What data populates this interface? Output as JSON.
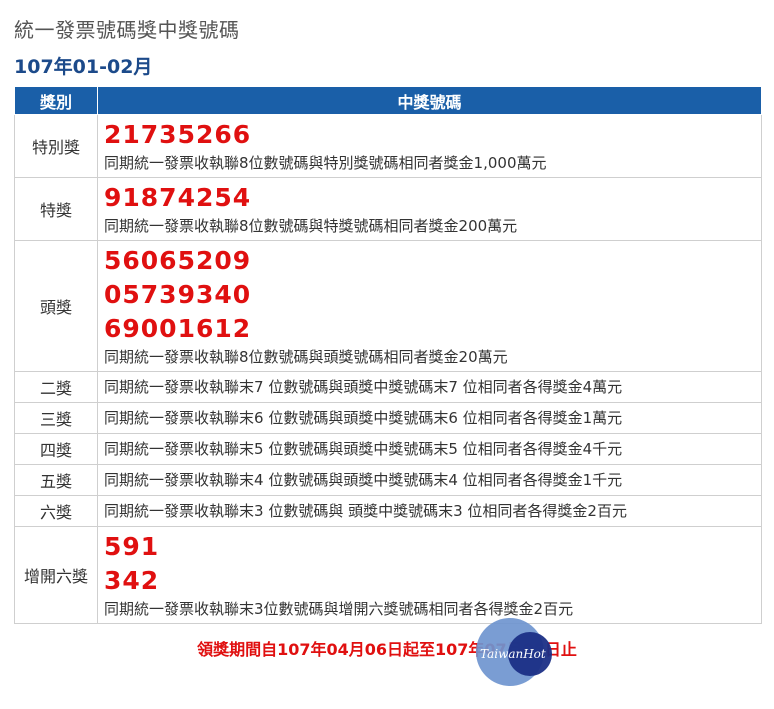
{
  "header": {
    "title": "統一發票號碼獎中獎號碼",
    "period": "107年01-02月"
  },
  "table": {
    "col_category": "獎別",
    "col_numbers": "中獎號碼",
    "rows": [
      {
        "category": "特別獎",
        "numbers": [
          "21735266"
        ],
        "desc": "同期統一發票收執聯8位數號碼與特別獎號碼相同者獎金1,000萬元"
      },
      {
        "category": "特獎",
        "numbers": [
          "91874254"
        ],
        "desc": "同期統一發票收執聯8位數號碼與特獎號碼相同者獎金200萬元"
      },
      {
        "category": "頭獎",
        "numbers": [
          "56065209",
          "05739340",
          "69001612"
        ],
        "desc": "同期統一發票收執聯8位數號碼與頭獎號碼相同者獎金20萬元"
      },
      {
        "category": "二獎",
        "desc": "同期統一發票收執聯末7 位數號碼與頭獎中獎號碼末7 位相同者各得獎金4萬元"
      },
      {
        "category": "三獎",
        "desc": "同期統一發票收執聯末6 位數號碼與頭獎中獎號碼末6 位相同者各得獎金1萬元"
      },
      {
        "category": "四獎",
        "desc": "同期統一發票收執聯末5 位數號碼與頭獎中獎號碼末5 位相同者各得獎金4千元"
      },
      {
        "category": "五獎",
        "desc": "同期統一發票收執聯末4 位數號碼與頭獎中獎號碼末4 位相同者各得獎金1千元"
      },
      {
        "category": "六獎",
        "desc": "同期統一發票收執聯末3 位數號碼與 頭獎中獎號碼末3 位相同者各得獎金2百元"
      },
      {
        "category": "增開六獎",
        "numbers": [
          "591",
          "342"
        ],
        "desc": "同期統一發票收執聯末3位數號碼與增開六獎號碼相同者各得獎金2百元"
      }
    ]
  },
  "footer": {
    "deadline": "領獎期間自107年04月06日起至107年07月05日止"
  },
  "watermark": {
    "text": "TaiwanHot",
    "icon": "taiwanhot-logo-icon",
    "colors": {
      "light": "#6f95cf",
      "dark": "#1b2f86"
    }
  }
}
